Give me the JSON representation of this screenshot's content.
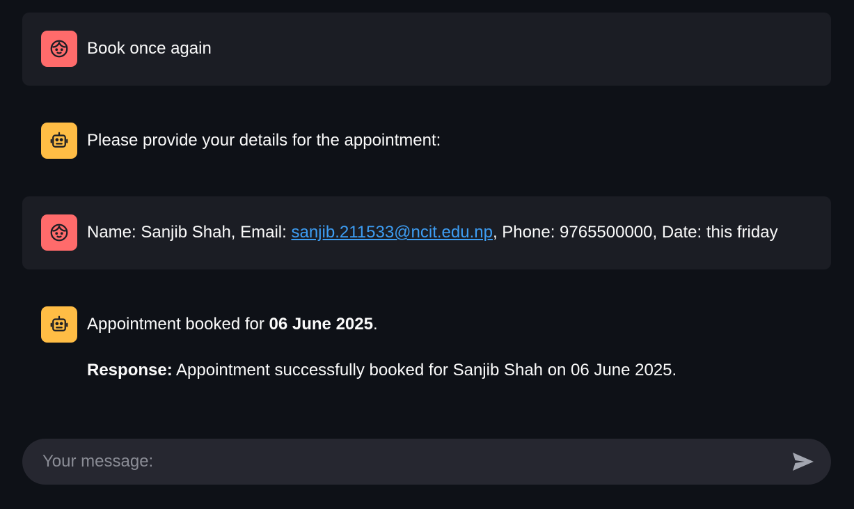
{
  "colors": {
    "background": "#0e1117",
    "user_bubble": "#1b1d24",
    "user_avatar": "#ff6b6b",
    "assistant_avatar": "#ffbd45",
    "link": "#3d9df3",
    "input_bg": "#262730"
  },
  "messages": [
    {
      "role": "user",
      "icon": "user-face-icon",
      "text": "Book once again"
    },
    {
      "role": "assistant",
      "icon": "robot-icon",
      "text": "Please provide your details for the appointment:"
    },
    {
      "role": "user",
      "icon": "user-face-icon",
      "text_prefix": "Name: Sanjib Shah, Email: ",
      "link_text": "sanjib.211533@ncit.edu.np",
      "text_suffix": ", Phone: 9765500000, Date: this friday"
    },
    {
      "role": "assistant",
      "icon": "robot-icon",
      "line1_prefix": "Appointment booked for ",
      "line1_bold": "06 June 2025",
      "line1_suffix": ".",
      "line2_bold": "Response:",
      "line2_text": " Appointment successfully booked for Sanjib Shah on 06 June 2025."
    }
  ],
  "input": {
    "placeholder": "Your message:",
    "value": "",
    "send_icon": "send-arrow-icon"
  }
}
